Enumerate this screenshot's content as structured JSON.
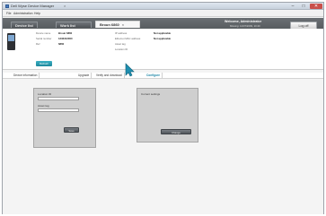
{
  "window": {
    "title": "Dell Wyse Device Manager",
    "title_close": "×",
    "min": "–",
    "max": "□",
    "close": "✕"
  },
  "menu": {
    "file": "File",
    "administration": "Administration",
    "help": "Help"
  },
  "tabs": {
    "home": "Device list",
    "worklist": "Work list",
    "device": "Broun 6860",
    "device_close": "×"
  },
  "header": {
    "welcome": "Welcome, Administrator",
    "session": "Missing: 12/07/2009, 10:40",
    "logoff": "Log off"
  },
  "device": {
    "name_label": "Device name",
    "name_value": "Broun 6860",
    "serial_label": "Serial number",
    "serial_value": "1232312000",
    "ref_label": "Ref",
    "ref_value": "6860",
    "ip_label": "IP address",
    "ip_value": "Not applicable",
    "ethernet_label": "Ethernet MAC address",
    "ethernet_value": "Not applicable",
    "asset_label": "Asset tag",
    "asset_value": "",
    "location_label": "Location ID",
    "location_value": "",
    "refresh": "Refresh"
  },
  "subtabs": [
    "Device information",
    "Upgrade",
    "Verify and download",
    "Configure"
  ],
  "left_panel": {
    "location_label": "Location ID",
    "location_value": "",
    "asset_label": "Asset tag",
    "asset_value": "",
    "save": "Save"
  },
  "right_panel": {
    "title": "Current settings",
    "change": "Change"
  },
  "colors": {
    "header_dark": "#3f4346",
    "accent_teal": "#1e879b",
    "panel_gray": "#cfcfcf"
  },
  "icons": {
    "app": "app-icon",
    "device": "device-icon",
    "cursor": "mouse-pointer-icon"
  }
}
